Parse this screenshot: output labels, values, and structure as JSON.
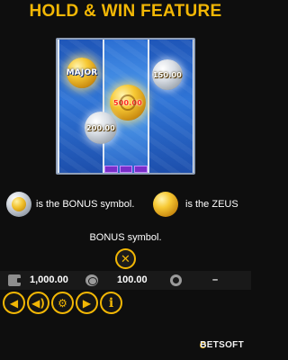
{
  "title": "HOLD & WIN FEATURE",
  "reel_coins": {
    "major": "MAJOR",
    "c1": "150.00",
    "c2": "500.00",
    "c3": "200.00"
  },
  "description": {
    "part1": "is the BONUS symbol.",
    "part2": "is the ZEUS",
    "part3": "BONUS symbol."
  },
  "close_glyph": "✕",
  "stats": {
    "balance": "1,000.00",
    "bet": "100.00",
    "win": "–"
  },
  "controls": {
    "back": "◀",
    "sound": "◀)",
    "settings": "⚙",
    "play": "▶",
    "info": "i"
  },
  "brand": "BETSOFT",
  "colors": {
    "accent": "#f2b705",
    "background": "#0e0e0e",
    "bar": "#191919"
  }
}
